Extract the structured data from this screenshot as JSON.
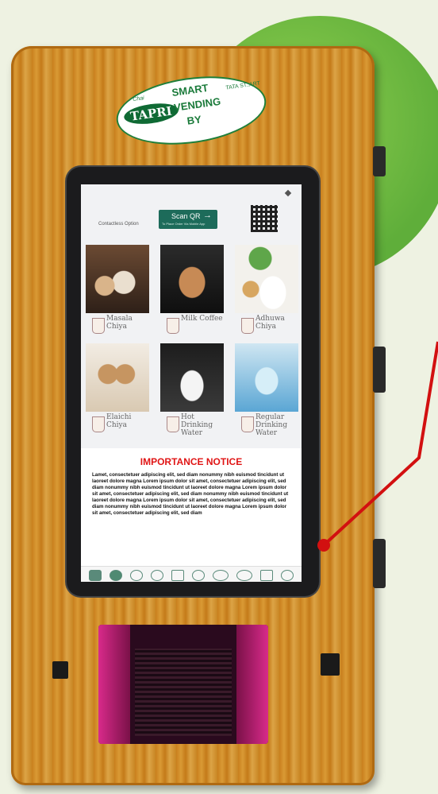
{
  "branding": {
    "small_tag": "Chai",
    "tapri": "TAPRI",
    "line1": "SMART",
    "line2": "VENDING",
    "line3": "BY",
    "mark_small": "TATA ST..ART"
  },
  "screen": {
    "contactless_label": "Contactless Option",
    "scan_button_label": "Scan QR",
    "scan_button_arrow": "→",
    "scan_button_sub": "To Place Order Via Mobile App"
  },
  "menu": [
    {
      "name": "Masala Chiya",
      "icon": "masala-chiya-photo"
    },
    {
      "name": "Milk Coffee",
      "icon": "milk-coffee-photo"
    },
    {
      "name": "Adhuwa Chiya",
      "icon": "adhuwa-chiya-photo"
    },
    {
      "name": "Elaichi Chiya",
      "icon": "elaichi-chiya-photo"
    },
    {
      "name": "Hot Drinking Water",
      "icon": "hot-water-photo"
    },
    {
      "name": "Regular Drinking Water",
      "icon": "regular-water-photo"
    }
  ],
  "notice": {
    "title": "IMPORTANCE NOTICE",
    "body": "Lamet, consectetuer adipiscing elit, sed diam nonummy nibh euismod tincidunt ut laoreet dolore magna Lorem ipsum dolor sit amet, consectetuer adipiscing elit, sed diam nonummy nibh euismod tincidunt ut laoreet dolore magna Lorem ipsum dolor sit amet, consectetuer adipiscing elit, sed diam nonummy nibh euismod tincidunt ut laoreet dolore magna Lorem ipsum dolor sit amet, consectetuer adipiscing elit, sed diam nonummy nibh euismod tincidunt ut laoreet dolore magna Lorem ipsum dolor sit amet, consectetuer adipiscing elit, sed diam"
  },
  "footer_badges": [
    "person-icon",
    "leaf-icon",
    "cloud-icon",
    "clock-icon",
    "gmo-free-badge",
    "face-icon",
    "gluten-free-badge",
    "organic-badge",
    "share-icon",
    "settings-icon"
  ],
  "colors": {
    "cabinet": "#d0902c",
    "scan_button": "#1d6b5a",
    "notice_title": "#e01515",
    "pointer": "#d21010",
    "background_circle": "#7fc44a"
  }
}
